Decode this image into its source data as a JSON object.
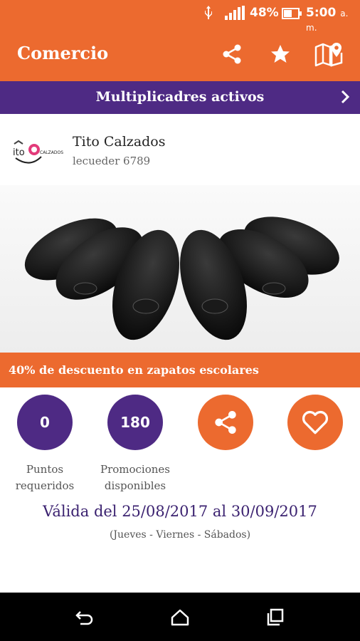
{
  "status_bar": {
    "battery_percent": "48%",
    "time": "5:00",
    "ampm": "a. m."
  },
  "app_bar": {
    "title": "Comercio",
    "icons": [
      "share-icon",
      "star-icon",
      "map-icon"
    ]
  },
  "multiplicadores": {
    "label": "Multiplicadres activos"
  },
  "store": {
    "name": "Tito Calzados",
    "code": "lecueder 6789",
    "logo_text": "CALZADOS"
  },
  "promo": {
    "text": "40% de descuento en zapatos escolares"
  },
  "stats": {
    "points_value": "0",
    "points_label_1": "Puntos",
    "points_label_2": "requeridos",
    "promos_value": "180",
    "promos_label_1": "Promociones",
    "promos_label_2": "disponibles"
  },
  "validity": {
    "range": "Válida del 25/08/2017 al 30/09/2017",
    "days": "(Jueves - Viernes - Sábados)"
  },
  "colors": {
    "orange": "#ec6a2f",
    "purple": "#4e2a84"
  }
}
